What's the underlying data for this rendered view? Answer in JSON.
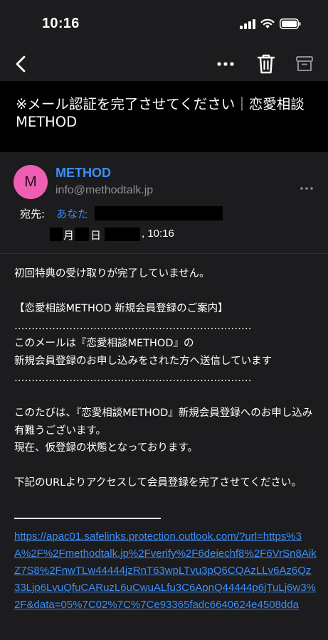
{
  "status_bar": {
    "time": "10:16",
    "icons": [
      "signal-icon",
      "wifi-icon",
      "battery-icon"
    ]
  },
  "toolbar": {
    "icons": [
      "chevron-left-icon",
      "more-icon",
      "trash-icon",
      "archive-icon"
    ]
  },
  "email": {
    "subject": "※メール認証を完了させてください｜恋愛相談METHOD",
    "sender": {
      "avatar_initial": "M",
      "name": "METHOD",
      "email": "info@methodtalk.jp"
    },
    "to_label": "宛先:",
    "to_value": "あなた",
    "date": {
      "month_suffix": "月",
      "day_suffix": "日",
      "time": ", 10:16"
    },
    "body": "初回特典の受け取りが完了していません。\n\n【恋愛相談METHOD 新規会員登録のご案内】\n……………………………………………………………\nこのメールは『恋愛相談METHOD』の\n新規会員登録のお申し込みをされた方へ送信しています\n……………………………………………………………\n\nこのたびは、『恋愛相談METHOD』新規会員登録へのお申し込み有難うございます。\n現在、仮登録の状態となっております。\n\n下記のURLよりアクセスして会員登録を完了させてください。",
    "link": "https://apac01.safelinks.protection.outlook.com/?url=https%3A%2F%2Fmethodtalk.jp%2Fverify%2F6deiechf8%2F6VrSn8AikZ7S8%2FnwTLw44444jzRnT63wpLTvu3pQ6CQAzLLv6Az6Qz33Ljp6LvuQfuCARuzL6uCwuALfu3C6ApnQ44444p6jTuLj6w3%2F&data=05%7C02%7C%7Ce93365fadc6640624e4508dda"
  },
  "colors": {
    "accent": "#3d8ef7",
    "avatar": "#ee5fb4",
    "background": "#000000",
    "panel": "#1c1c1e",
    "muted": "#8e8e93"
  }
}
